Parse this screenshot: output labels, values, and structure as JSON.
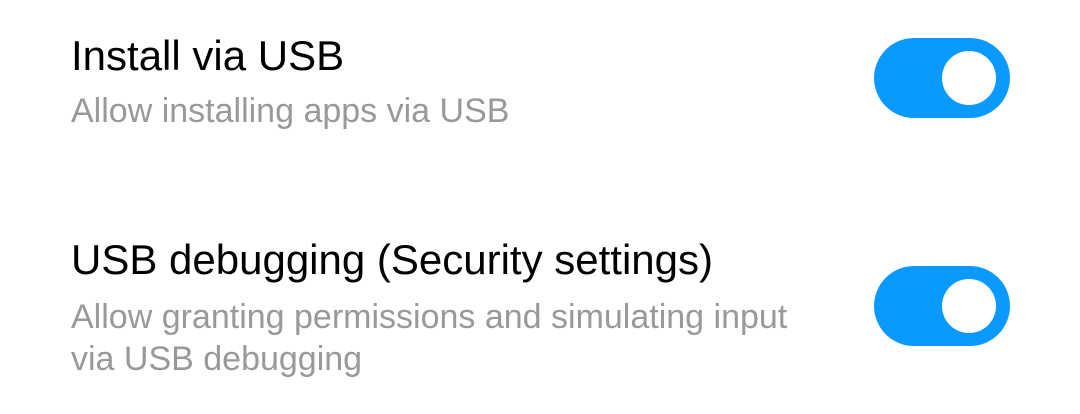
{
  "accent_color": "#0a99ff",
  "settings": [
    {
      "title": "Install via USB",
      "subtitle": "Allow installing apps via USB",
      "enabled": true
    },
    {
      "title": "USB debugging (Security settings)",
      "subtitle": "Allow granting permissions and simulating input via USB debugging",
      "enabled": true
    }
  ]
}
